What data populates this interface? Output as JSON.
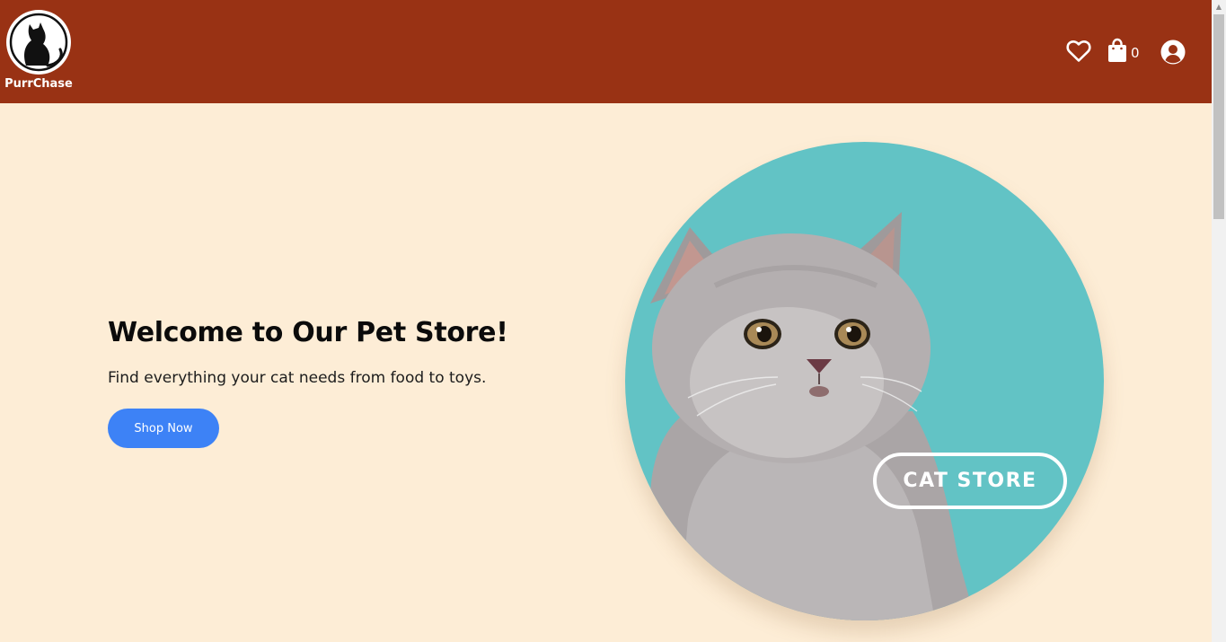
{
  "brand": {
    "name": "PurrChase",
    "logo_icon": "cat-silhouette-icon"
  },
  "header": {
    "icons": [
      "heart-icon",
      "shopping-bag-icon",
      "user-circle-icon"
    ],
    "cart_count": "0"
  },
  "hero": {
    "title": "Welcome to Our Pet Store!",
    "subtitle": "Find everything your cat needs from food to toys.",
    "cta_label": "Shop Now",
    "badge_label": "CAT STORE"
  },
  "colors": {
    "header_bg": "#993214",
    "page_bg": "#fdedd6",
    "cta_bg": "#3d82f6",
    "image_bg": "#62c3c5"
  }
}
